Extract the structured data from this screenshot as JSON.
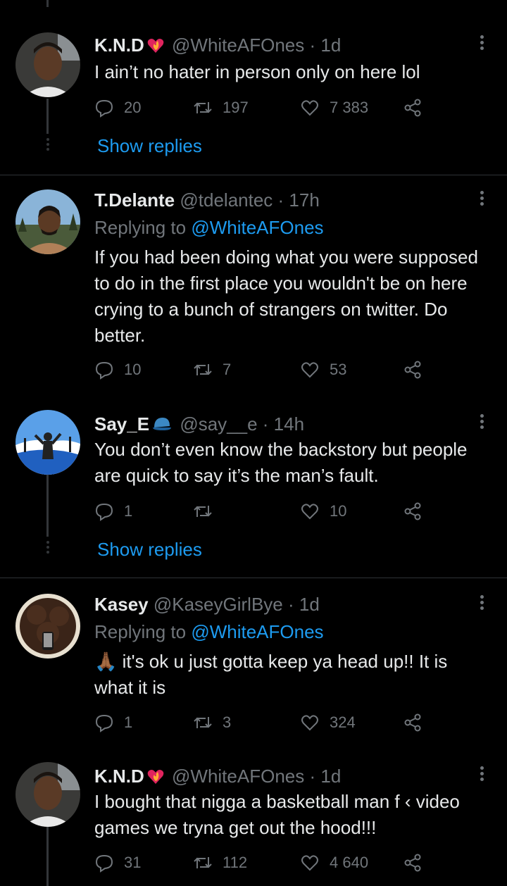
{
  "tweets": [
    {
      "name": "K.N.D",
      "handle": "@WhiteAFOnes",
      "time": "· 1d",
      "text": "I ain’t no hater in person only on here lol",
      "replies": "20",
      "retweets": "197",
      "likes": "7 383"
    },
    {
      "name": "T.Delante",
      "handle": "@tdelantec",
      "time": "· 17h",
      "replying_prefix": "Replying to",
      "replying_to": "@WhiteAFOnes",
      "text": "If you had been doing what you were supposed to do in the first place you wouldn't be on here crying to a bunch of strangers on twitter. Do better.",
      "replies": "10",
      "retweets": "7",
      "likes": "53"
    },
    {
      "name": "Say_E",
      "handle": "@say__e",
      "time": "· 14h",
      "text": "You don’t even know the backstory but people are quick to say it’s the man’s fault.",
      "replies": "1",
      "retweets": "",
      "likes": "10"
    },
    {
      "name": "Kasey",
      "handle": "@KaseyGirlBye",
      "time": "· 1d",
      "replying_prefix": "Replying to",
      "replying_to": "@WhiteAFOnes",
      "emoji": "🙏🏾",
      "text": " it's ok u just gotta keep ya head up!! It is what it is",
      "replies": "1",
      "retweets": "3",
      "likes": "324"
    },
    {
      "name": "K.N.D",
      "handle": "@WhiteAFOnes",
      "time": "· 1d",
      "text": "I bought that nigga a basketball man f      ‹ video games we tryna get out the hood!!!",
      "replies": "31",
      "retweets": "112",
      "likes": "4 640"
    }
  ],
  "show_replies_label": "Show replies",
  "colors": {
    "background": "#000000",
    "text": "#e7e9ea",
    "secondary": "#71767b",
    "accent": "#1d9bf0",
    "divider": "#2f3336"
  },
  "icons": [
    "reply-icon",
    "retweet-icon",
    "like-icon",
    "share-icon",
    "more-icon",
    "heart-fire-emoji",
    "blue-cap-emoji"
  ]
}
